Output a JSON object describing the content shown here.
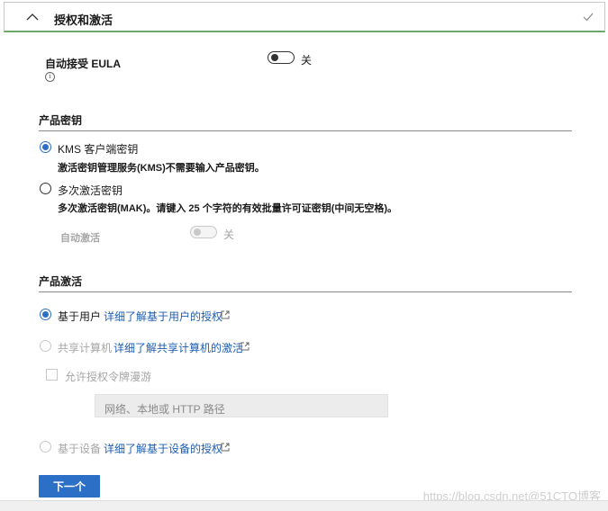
{
  "header": {
    "title": "授权和激活"
  },
  "eula": {
    "label": "自动接受 EULA",
    "toggle_text": "关",
    "toggle_on": false
  },
  "product_key": {
    "title": "产品密钥",
    "kms": {
      "label": "KMS 客户端密钥",
      "desc": "激活密钥管理服务(KMS)不需要输入产品密钥。",
      "checked": true
    },
    "mak": {
      "label": "多次激活密钥",
      "desc": "多次激活密钥(MAK)。请键入 25 个字符的有效批量许可证密钥(中间无空格)。",
      "checked": false
    },
    "auto_activate": {
      "label": "自动激活",
      "toggle_text": "关",
      "toggle_on": false
    }
  },
  "activation": {
    "title": "产品激活",
    "user": {
      "label": "基于用户",
      "link": "详细了解基于用户的授权",
      "checked": true
    },
    "shared": {
      "label": "共享计算机",
      "link": "详细了解共享计算机的激活",
      "checked": false
    },
    "roaming": {
      "label": "允许授权令牌漫游",
      "checked": false
    },
    "path_input": {
      "placeholder": "网络、本地或 HTTP 路径",
      "value": ""
    },
    "device": {
      "label": "基于设备",
      "link": "详细了解基于设备的授权",
      "checked": false
    }
  },
  "buttons": {
    "next": "下一个"
  },
  "watermark": "https://blog.csdn.net@51CTO博客",
  "colors": {
    "accent": "#2b6fc7",
    "link": "#1f5fb3",
    "header_border": "#6ea56a"
  }
}
